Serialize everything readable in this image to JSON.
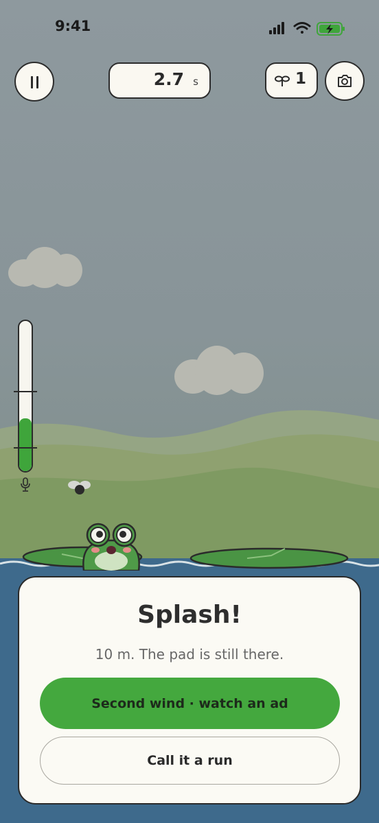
{
  "status_bar": {
    "time": "9:41"
  },
  "hud": {
    "timer_value": "2.7",
    "timer_unit": "s",
    "seed_count": "1",
    "breath_level": 0.35
  },
  "result_panel": {
    "title": "Splash!",
    "subtitle": "10 m. The pad is still there.",
    "primary_button": "Second wind · watch an ad",
    "secondary_button": "Call it a run"
  },
  "colors": {
    "accent_green": "#44a83e",
    "water": "#3e6a8c",
    "panel_bg": "#fbfaf4"
  }
}
